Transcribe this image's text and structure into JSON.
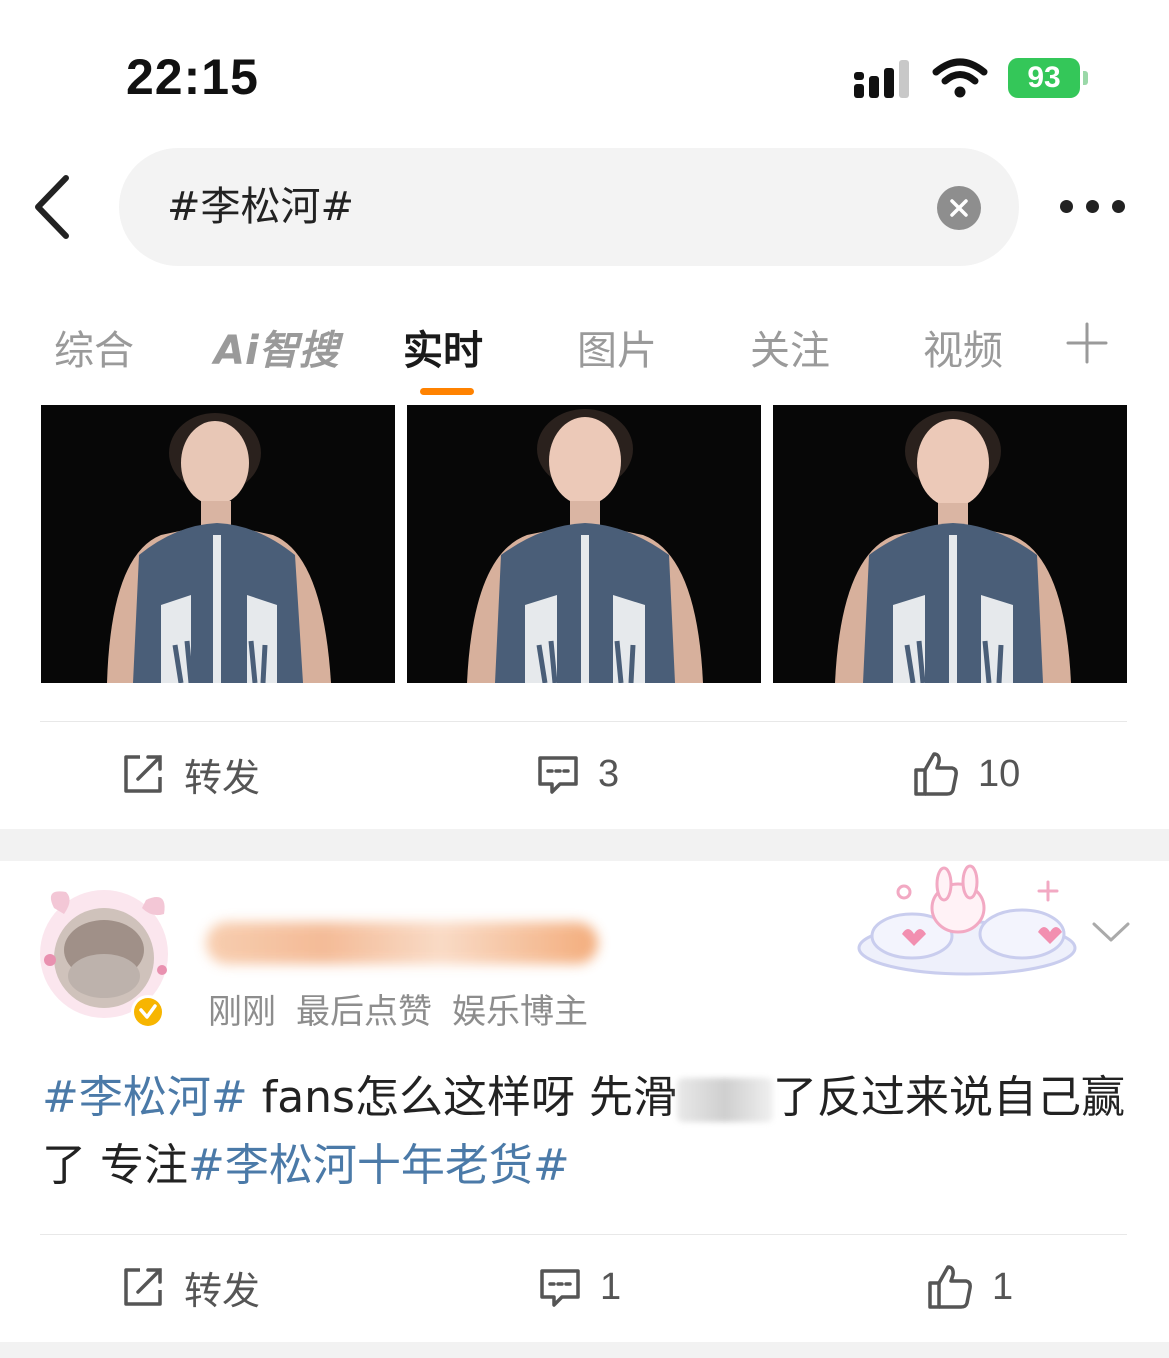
{
  "status_bar": {
    "time": "22:15",
    "battery": "93"
  },
  "search": {
    "query": "#李松河#"
  },
  "tabs": [
    {
      "label": "综合",
      "active": false
    },
    {
      "label": "Ai智搜",
      "active": false
    },
    {
      "label": "实时",
      "active": true
    },
    {
      "label": "图片",
      "active": false
    },
    {
      "label": "关注",
      "active": false
    },
    {
      "label": "视频",
      "active": false
    }
  ],
  "post1": {
    "actions": {
      "repost_label": "转发",
      "comments": "3",
      "likes": "10"
    }
  },
  "post2": {
    "meta": {
      "time": "刚刚",
      "activity": "最后点赞",
      "role": "娱乐博主"
    },
    "content": {
      "tag1": "#李松河#",
      "text_a": " fans怎么这样呀 先滑",
      "text_b": "了反过来说自己赢了 专注",
      "tag2": "#李松河十年老货#"
    },
    "actions": {
      "repost_label": "转发",
      "comments": "1",
      "likes": "1"
    }
  },
  "colors": {
    "accent": "#ff8200",
    "tag": "#4b7aa8",
    "battery": "#34c759"
  }
}
